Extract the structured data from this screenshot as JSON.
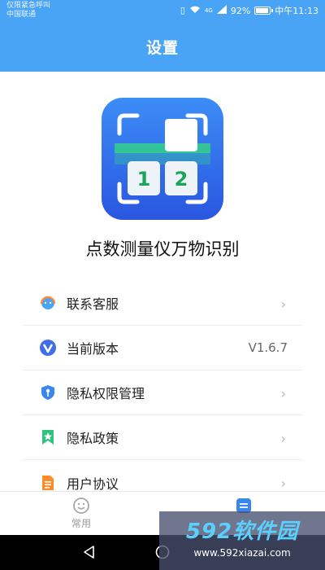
{
  "status_bar": {
    "carrier_line1": "仅限紧急呼叫",
    "carrier_line2": "中国联通",
    "signal_text": "4G",
    "battery_percent": "92%",
    "battery_level": 0.92,
    "time": "中午11:13"
  },
  "header": {
    "title": "设置"
  },
  "app": {
    "logo_digit_left": "1",
    "logo_digit_right": "2",
    "name": "点数测量仪万物识别"
  },
  "menu": {
    "items": [
      {
        "label": "联系客服",
        "icon": "headset-icon",
        "value": "",
        "chevron": "›"
      },
      {
        "label": "当前版本",
        "icon": "version-v-icon",
        "value": "V1.6.7",
        "chevron": ""
      },
      {
        "label": "隐私权限管理",
        "icon": "shield-key-icon",
        "value": "",
        "chevron": "›"
      },
      {
        "label": "隐私政策",
        "icon": "bookmark-star-icon",
        "value": "",
        "chevron": "›"
      },
      {
        "label": "用户协议",
        "icon": "document-icon",
        "value": "",
        "chevron": "›"
      }
    ]
  },
  "bottom_nav": {
    "tabs": [
      {
        "label": "常用",
        "icon": "smile-face-icon",
        "active": false
      },
      {
        "label": "",
        "icon": "settings-doc-icon",
        "active": true
      }
    ]
  },
  "watermark": {
    "brand": "592软件园",
    "url": "www.592xiazai.com"
  },
  "colors": {
    "header_blue": "#4aa4f5",
    "accent_green": "#2ecc71",
    "logo_blue": "#2f6ef0"
  }
}
